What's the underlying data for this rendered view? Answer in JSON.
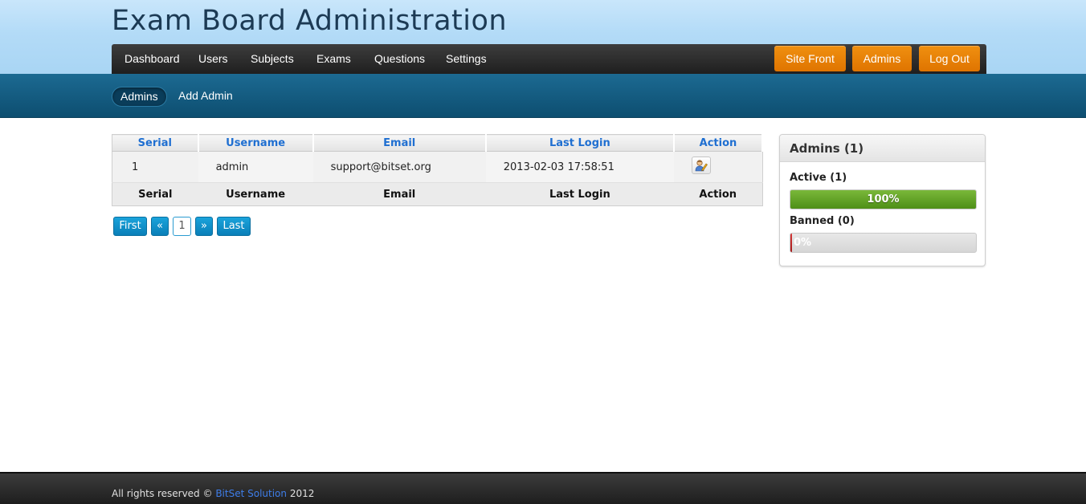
{
  "header": {
    "title": "Exam Board Administration"
  },
  "main_nav": {
    "items": [
      "Dashboard",
      "Users",
      "Subjects",
      "Exams",
      "Questions",
      "Settings"
    ],
    "buttons": [
      "Site Front",
      "Admins",
      "Log Out"
    ]
  },
  "sub_nav": {
    "items": [
      "Admins",
      "Add Admin"
    ],
    "active": "Admins"
  },
  "table": {
    "headers": [
      "Serial",
      "Username",
      "Email",
      "Last Login",
      "Action"
    ],
    "rows": [
      [
        "1",
        "admin",
        "support@bitset.org",
        "2013-02-03 17:58:51"
      ]
    ],
    "footers": [
      "Serial",
      "Username",
      "Email",
      "Last Login",
      "Action"
    ],
    "action_icon": "edit-user-icon"
  },
  "pagination": {
    "first": "First",
    "prev": "«",
    "current": "1",
    "next": "»",
    "last": "Last"
  },
  "stats_panel": {
    "title": "Admins (1)",
    "active_label": "Active (1)",
    "active_fraction": 1.0,
    "active_text": "100%",
    "banned_label": "Banned (0)",
    "banned_fraction": 0.0,
    "banned_text": "0%"
  },
  "footer": {
    "prefix": "All rights reserved ©",
    "link": "BitSet Solution",
    "year": "2012"
  },
  "colors": {
    "accent_orange": "#e67e00",
    "link_blue": "#1f6fd1",
    "progress_green": "#5f9f22",
    "progress_red": "#b82222"
  }
}
